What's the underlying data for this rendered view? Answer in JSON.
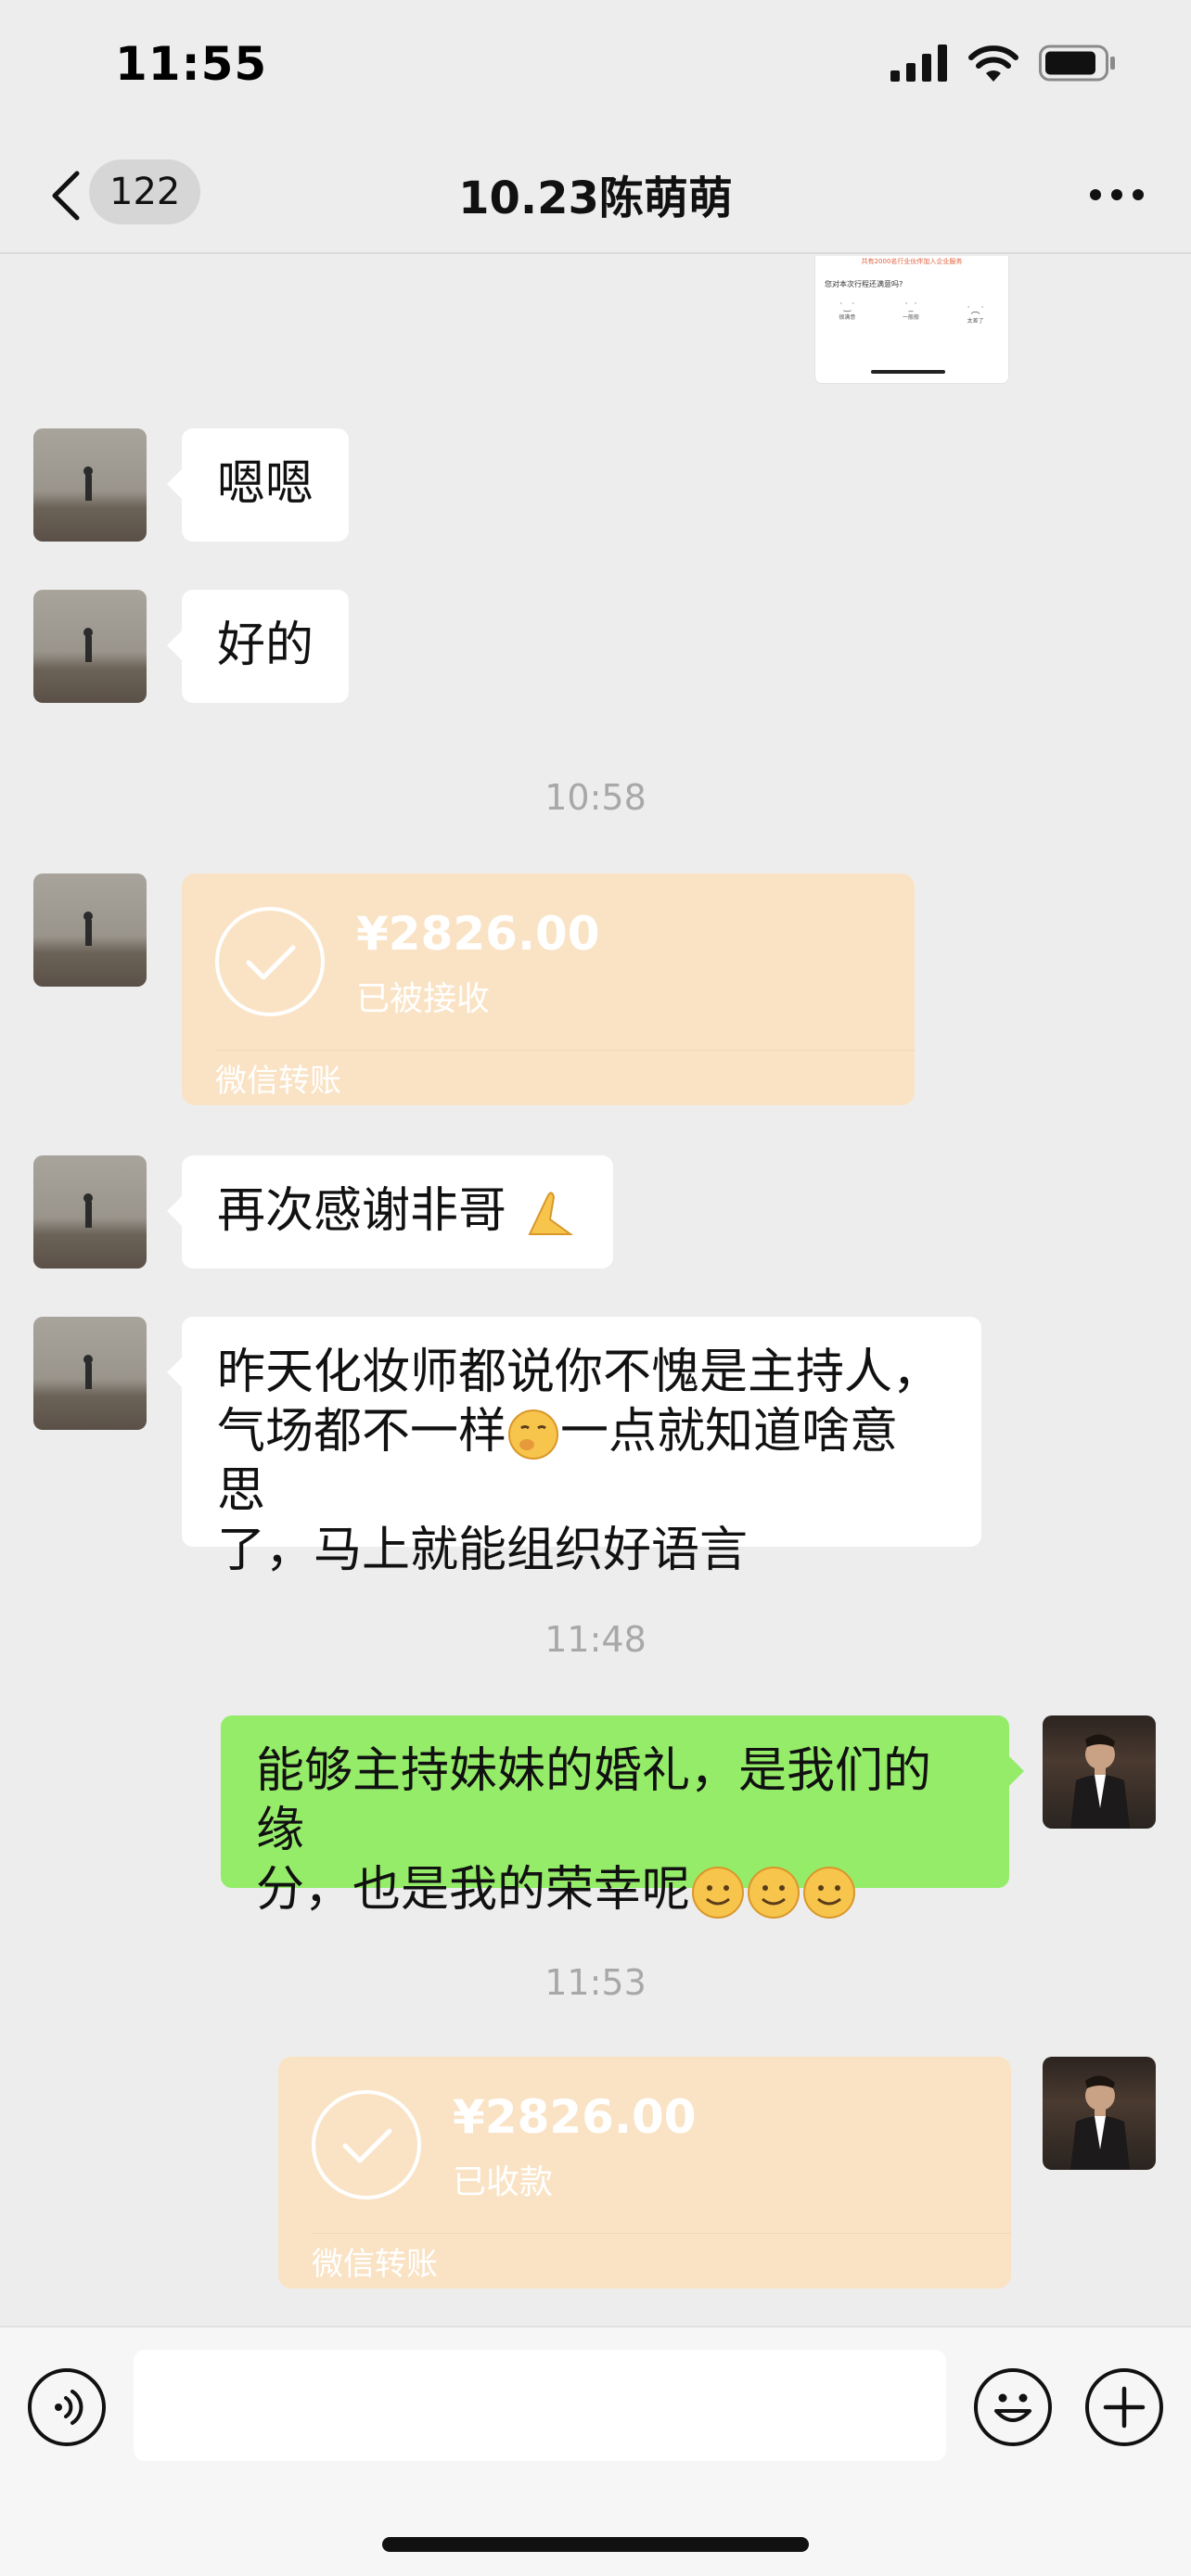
{
  "status_bar": {
    "time": "11:55"
  },
  "nav": {
    "unread_count": "122",
    "title": "10.23陈萌萌"
  },
  "thumbnail": {
    "header_text": "共有2000名行业伙伴加入企业服务",
    "question_text": "您对本次行程还满意吗?",
    "option_1": "很满意",
    "option_2": "一般般",
    "option_3": "太差了"
  },
  "messages": [
    {
      "sender": "contact",
      "type": "text",
      "text": "嗯嗯"
    },
    {
      "sender": "contact",
      "type": "text",
      "text": "好的"
    },
    {
      "type": "timestamp",
      "text": "10:58"
    },
    {
      "sender": "contact",
      "type": "transfer",
      "amount": "¥2826.00",
      "status": "已被接收",
      "label": "微信转账"
    },
    {
      "sender": "contact",
      "type": "text",
      "text": "再次感谢非哥",
      "emoji": "pray-hands-emoji"
    },
    {
      "sender": "contact",
      "type": "text",
      "line1": "昨天化妆师都说你不愧是主持人，",
      "line2a": "气场都不一样",
      "line2b": "一点就知道啥意思",
      "line3": "了，马上就能组织好语言",
      "emoji": "yawning-face-emoji"
    },
    {
      "type": "timestamp",
      "text": "11:48"
    },
    {
      "sender": "me",
      "type": "text",
      "line1": "能够主持妹妹的婚礼，是我们的缘",
      "line2": "分，也是我的荣幸呢",
      "emoji": "smiling-face-emoji"
    },
    {
      "type": "timestamp",
      "text": "11:53"
    },
    {
      "sender": "me",
      "type": "transfer",
      "amount": "¥2826.00",
      "status": "已收款",
      "label": "微信转账"
    }
  ],
  "colors": {
    "background": "#ededed",
    "bubble_incoming": "#ffffff",
    "bubble_outgoing": "#95ec69",
    "transfer_card": "#fae3c5",
    "timestamp": "#a8a8a8"
  },
  "input_bar": {
    "value": ""
  }
}
